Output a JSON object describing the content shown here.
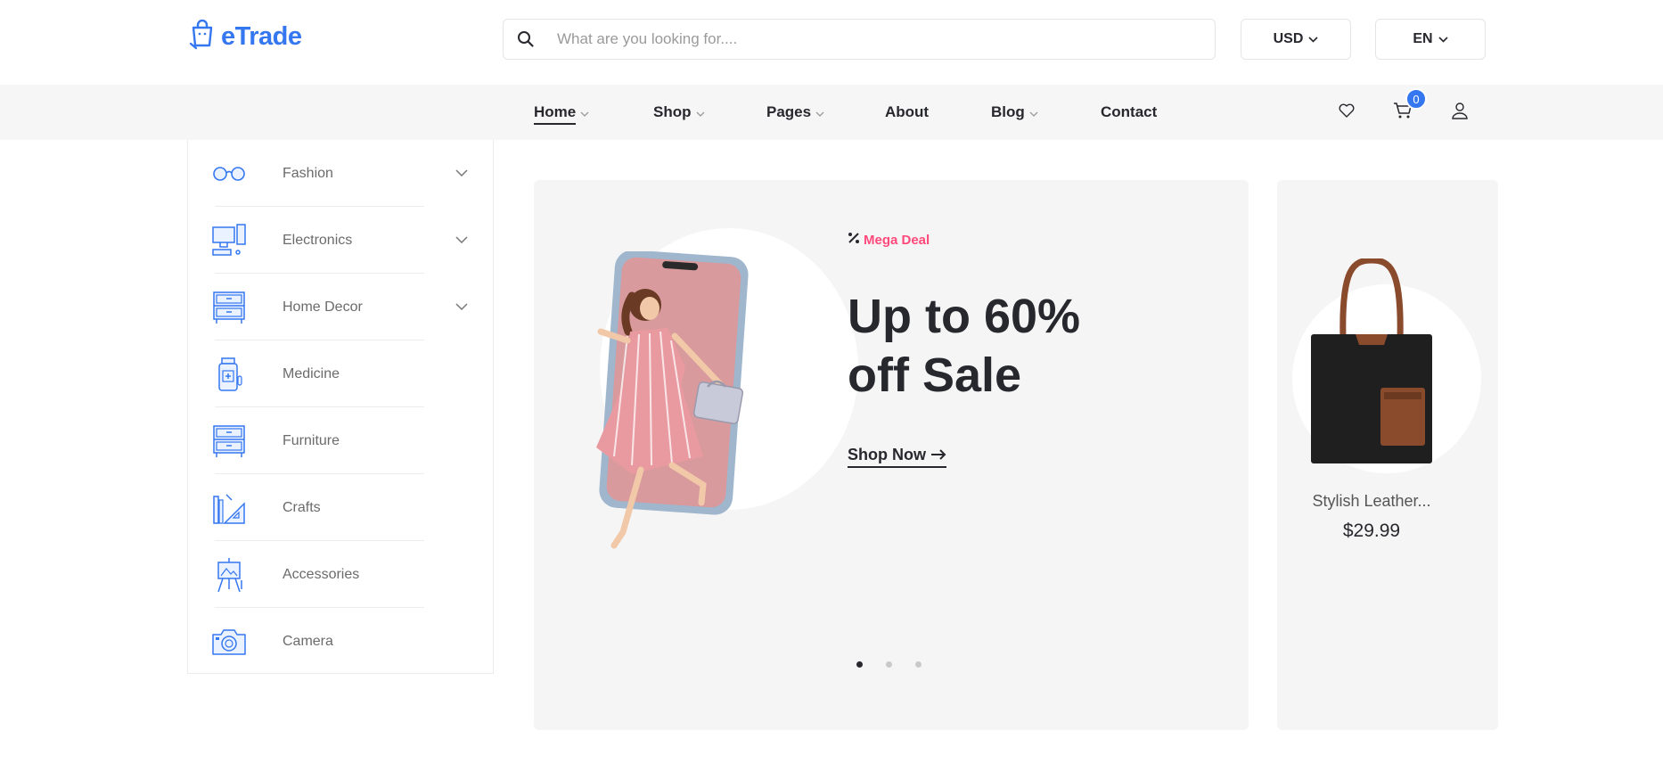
{
  "brand": {
    "name": "eTrade",
    "color": "#3577f0"
  },
  "search": {
    "placeholder": "What are you looking for...."
  },
  "currency": {
    "selected": "USD"
  },
  "language": {
    "selected": "EN"
  },
  "nav": {
    "items": [
      {
        "label": "Home",
        "has_dropdown": true,
        "active": true
      },
      {
        "label": "Shop",
        "has_dropdown": true
      },
      {
        "label": "Pages",
        "has_dropdown": true
      },
      {
        "label": "About",
        "has_dropdown": false
      },
      {
        "label": "Blog",
        "has_dropdown": true
      },
      {
        "label": "Contact",
        "has_dropdown": false
      }
    ],
    "icons": [
      "heart-icon",
      "cart-icon",
      "user-icon"
    ],
    "cart_count": "0"
  },
  "categories": [
    {
      "label": "Fashion",
      "icon": "glasses-icon",
      "expandable": true
    },
    {
      "label": "Electronics",
      "icon": "computer-icon",
      "expandable": true
    },
    {
      "label": "Home Decor",
      "icon": "cabinet-icon",
      "expandable": true
    },
    {
      "label": "Medicine",
      "icon": "medicine-bottle-icon",
      "expandable": false
    },
    {
      "label": "Furniture",
      "icon": "drawer-icon",
      "expandable": false
    },
    {
      "label": "Crafts",
      "icon": "ruler-icon",
      "expandable": false
    },
    {
      "label": "Accessories",
      "icon": "easel-icon",
      "expandable": false
    },
    {
      "label": "Camera",
      "icon": "camera-icon",
      "expandable": false
    }
  ],
  "hero": {
    "tag": "Mega Deal",
    "tag_color": "#ff497c",
    "title_line1": "Up to 60%",
    "title_line2": "off Sale",
    "cta": "Shop Now",
    "slide_count": 3,
    "active_slide": 1
  },
  "side_product": {
    "name": "Stylish Leather...",
    "price": "$29.99"
  }
}
